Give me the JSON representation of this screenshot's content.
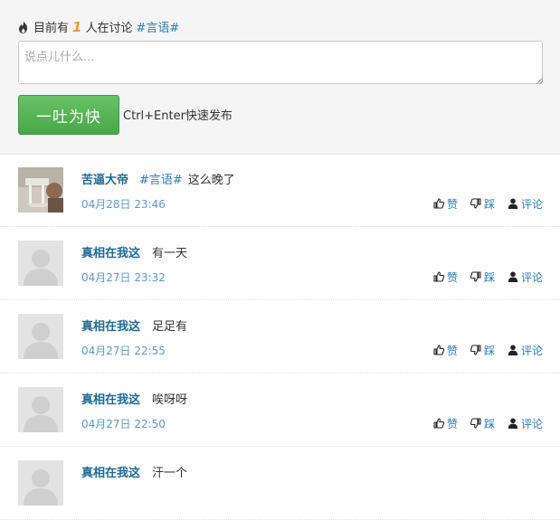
{
  "header": {
    "prefix": "目前有",
    "count": "1",
    "suffix": "人在讨论",
    "topic": "#言语#"
  },
  "input": {
    "placeholder": "说点儿什么..."
  },
  "submit": {
    "label": "一吐为快",
    "hint": "Ctrl+Enter快速发布"
  },
  "labels": {
    "like": "赞",
    "dislike": "踩",
    "comment": "评论"
  },
  "comments": [
    {
      "author": "苦逼大帝",
      "tag": "#言语#",
      "text": "这么晚了",
      "time": "04月28日 23:46",
      "avatar": "photo"
    },
    {
      "author": "真相在我这",
      "tag": "",
      "text": "有一天",
      "time": "04月27日 23:32",
      "avatar": "default"
    },
    {
      "author": "真相在我这",
      "tag": "",
      "text": "足足有",
      "time": "04月27日 22:55",
      "avatar": "default"
    },
    {
      "author": "真相在我这",
      "tag": "",
      "text": "唉呀呀",
      "time": "04月27日 22:50",
      "avatar": "default"
    },
    {
      "author": "真相在我这",
      "tag": "",
      "text": "汗一个",
      "time": "",
      "avatar": "default"
    }
  ],
  "colors": {
    "accent": "#2b7bb9",
    "author": "#1e6b96",
    "count": "#f29c1a",
    "button": "#52b052"
  }
}
